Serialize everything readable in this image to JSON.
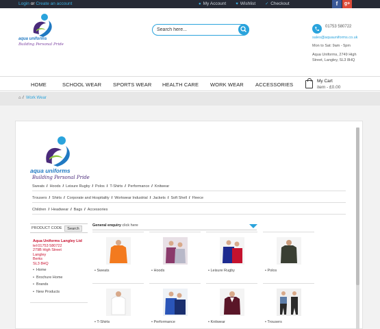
{
  "topbar": {
    "login": "Login",
    "or": "or",
    "create": "Create an account",
    "my_account": "My Account",
    "wishlist": "Wishlist",
    "checkout": "Checkout",
    "facebook": "f",
    "googleplus": "g+"
  },
  "header": {
    "logo_text": "aqua uniforms",
    "logo_tagline": "Building Personal Pride",
    "search_placeholder": "Search here...",
    "phone": "01753 580722",
    "email": "sales@aquauniforms.co.uk",
    "hours": "Mon to Sat: 9am - 5pm",
    "address": "Aqua Uniforms, 2749 High Street, Langley, SL3 8HQ"
  },
  "nav": {
    "items": [
      "HOME",
      "SCHOOL WEAR",
      "SPORTS WEAR",
      "HEALTH CARE",
      "WORK WEAR",
      "ACCESSORIES"
    ],
    "cart_title": "My Cart",
    "cart_summary": "item - £0.00"
  },
  "breadcrumb": {
    "current": "Work Wear"
  },
  "inner": {
    "logo_text": "aqua uniforms",
    "logo_tagline": "Building Personal Pride",
    "cat_rows": [
      [
        "Sweats",
        "Hoods",
        "Leisure Rugby",
        "Polos",
        "T-Shirts",
        "Performance",
        "Knitwear"
      ],
      [
        "Trousers",
        "Shirts",
        "Corporate and Hospitality",
        "Workwear Industrial",
        "Jackets",
        "Soft Shell",
        "Fleece"
      ],
      [
        "Children",
        "Headwear",
        "Bags",
        "Accessories"
      ]
    ],
    "product_code_label": "PRODUCT CODE",
    "search_button": "Search",
    "shop": {
      "name": "Aqua Uniforms Langley Ltd",
      "tel": "tel:01753 580722",
      "street": "279B High Street",
      "town": "Langley",
      "county": "Berks",
      "postcode": "SL3 8HQ"
    },
    "side_links": [
      "Home",
      "Brochure Home",
      "Brands",
      "New Products"
    ],
    "enquiry_bold": "General enquiry",
    "enquiry_rest": "click here",
    "products": [
      "Sweats",
      "Hoods",
      "Leisure Rugby",
      "Polos",
      "T-Shirts",
      "Performance",
      "Knitwear",
      "Trousers"
    ]
  },
  "colors": {
    "accent": "#2aa3dc",
    "topbar": "#262a35",
    "shop_text": "#c8102e"
  }
}
